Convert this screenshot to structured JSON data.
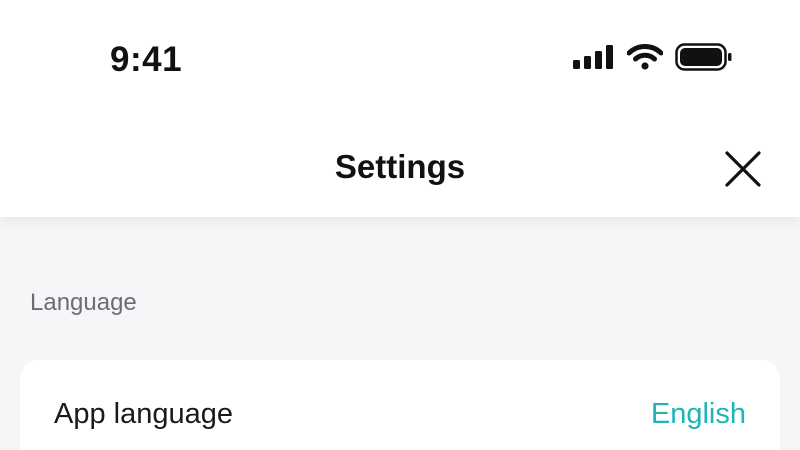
{
  "status_bar": {
    "time": "9:41",
    "icons": [
      "cellular-signal-icon",
      "wifi-icon",
      "battery-icon"
    ]
  },
  "header": {
    "title": "Settings",
    "close_icon": "close-icon"
  },
  "sections": [
    {
      "label": "Language",
      "rows": [
        {
          "label": "App language",
          "value": "English"
        }
      ]
    }
  ],
  "colors": {
    "accent": "#1fb5b8",
    "background": "#f6f6f8",
    "section_label": "#6d6d72"
  }
}
